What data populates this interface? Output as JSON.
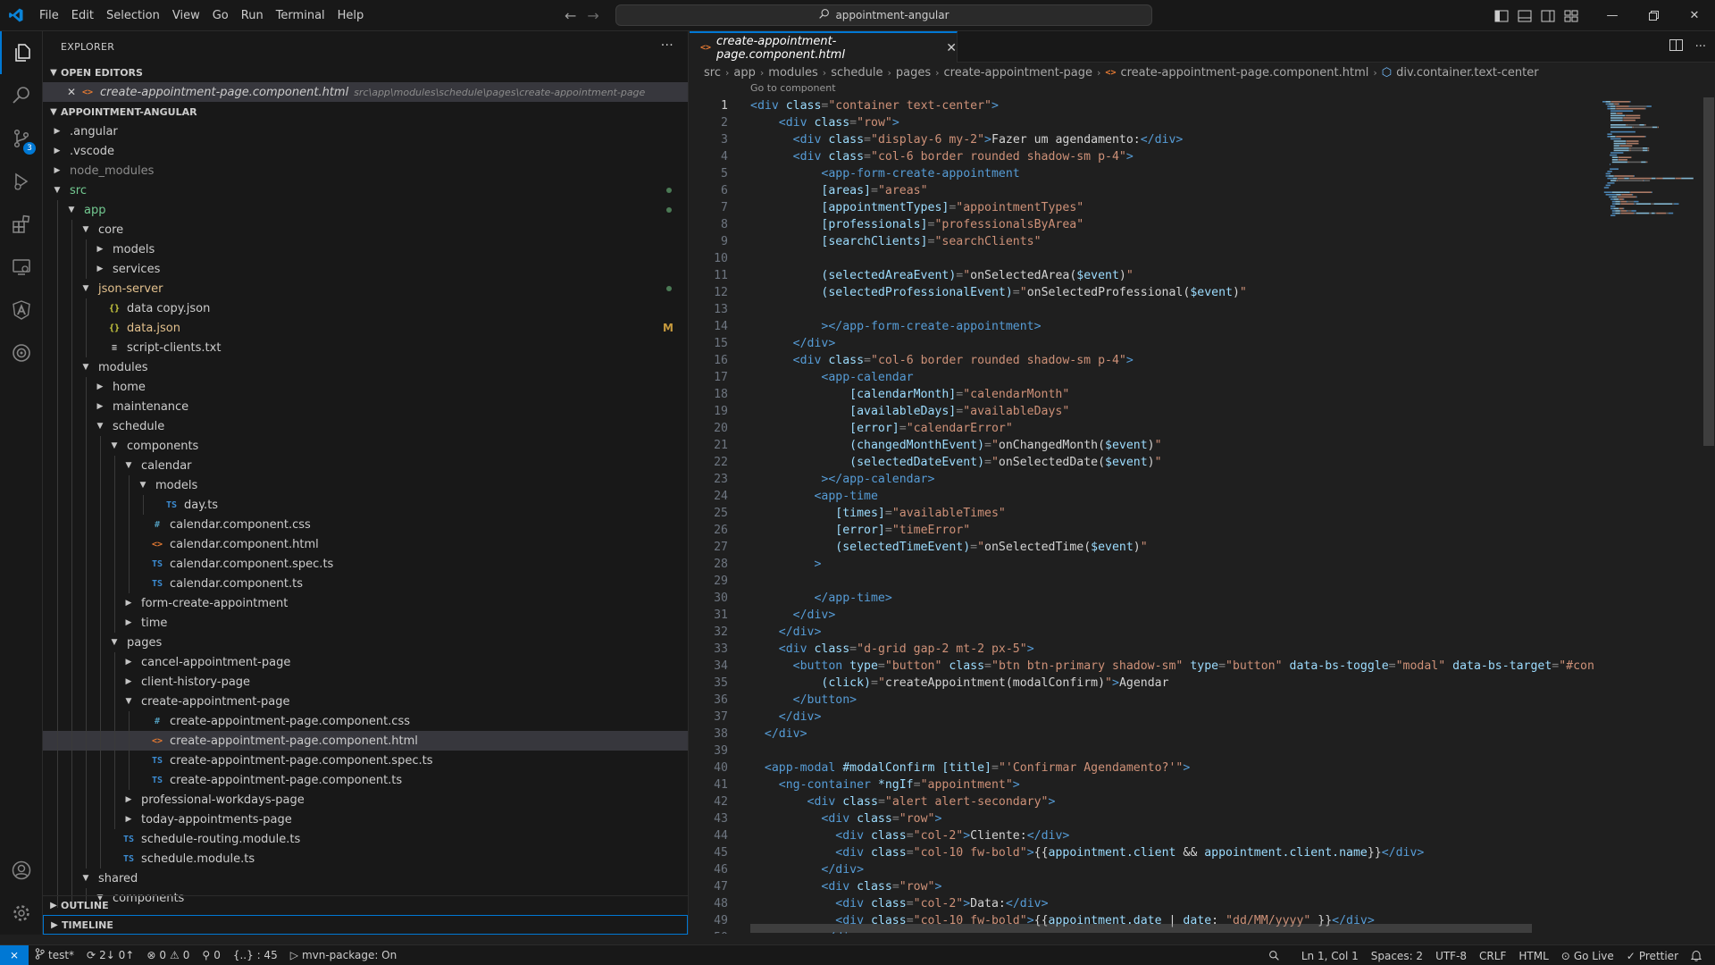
{
  "menu": [
    "File",
    "Edit",
    "Selection",
    "View",
    "Go",
    "Run",
    "Terminal",
    "Help"
  ],
  "command_center": "appointment-angular",
  "activity_badge": "3",
  "explorer": {
    "title": "EXPLORER",
    "open_editors_label": "OPEN EDITORS",
    "open_editor": {
      "name": "create-appointment-page.component.html",
      "path": "src\\app\\modules\\schedule\\pages\\create-appointment-page"
    },
    "project_label": "APPOINTMENT-ANGULAR",
    "tree": [
      {
        "depth": 0,
        "chev": ">",
        "name": ".angular"
      },
      {
        "depth": 0,
        "chev": ">",
        "name": ".vscode"
      },
      {
        "depth": 0,
        "chev": ">",
        "name": "node_modules",
        "dim": true
      },
      {
        "depth": 0,
        "chev": "v",
        "name": "src",
        "dot": true,
        "color": "#73c991"
      },
      {
        "depth": 1,
        "chev": "v",
        "name": "app",
        "dot": true,
        "color": "#73c991"
      },
      {
        "depth": 2,
        "chev": "v",
        "name": "core"
      },
      {
        "depth": 3,
        "chev": ">",
        "name": "models"
      },
      {
        "depth": 3,
        "chev": ">",
        "name": "services"
      },
      {
        "depth": 2,
        "chev": "v",
        "name": "json-server",
        "dot": true,
        "color": "#e2c08d"
      },
      {
        "depth": 3,
        "icon": "{}",
        "iclass": "i-json",
        "name": "data copy.json"
      },
      {
        "depth": 3,
        "icon": "{}",
        "iclass": "i-json",
        "name": "data.json",
        "mflag": "M",
        "color": "#e2c08d"
      },
      {
        "depth": 3,
        "icon": "≡",
        "iclass": "i-txt",
        "name": "script-clients.txt"
      },
      {
        "depth": 2,
        "chev": "v",
        "name": "modules"
      },
      {
        "depth": 3,
        "chev": ">",
        "name": "home"
      },
      {
        "depth": 3,
        "chev": ">",
        "name": "maintenance"
      },
      {
        "depth": 3,
        "chev": "v",
        "name": "schedule"
      },
      {
        "depth": 4,
        "chev": "v",
        "name": "components"
      },
      {
        "depth": 5,
        "chev": "v",
        "name": "calendar"
      },
      {
        "depth": 6,
        "chev": "v",
        "name": "models"
      },
      {
        "depth": 7,
        "icon": "TS",
        "iclass": "i-ts",
        "name": "day.ts"
      },
      {
        "depth": 6,
        "icon": "#",
        "iclass": "i-css",
        "name": "calendar.component.css"
      },
      {
        "depth": 6,
        "icon": "<>",
        "iclass": "i-html",
        "name": "calendar.component.html"
      },
      {
        "depth": 6,
        "icon": "TS",
        "iclass": "i-ts",
        "name": "calendar.component.spec.ts"
      },
      {
        "depth": 6,
        "icon": "TS",
        "iclass": "i-ts",
        "name": "calendar.component.ts"
      },
      {
        "depth": 5,
        "chev": ">",
        "name": "form-create-appointment"
      },
      {
        "depth": 5,
        "chev": ">",
        "name": "time"
      },
      {
        "depth": 4,
        "chev": "v",
        "name": "pages"
      },
      {
        "depth": 5,
        "chev": ">",
        "name": "cancel-appointment-page"
      },
      {
        "depth": 5,
        "chev": ">",
        "name": "client-history-page"
      },
      {
        "depth": 5,
        "chev": "v",
        "name": "create-appointment-page"
      },
      {
        "depth": 6,
        "icon": "#",
        "iclass": "i-css",
        "name": "create-appointment-page.component.css"
      },
      {
        "depth": 6,
        "icon": "<>",
        "iclass": "i-html",
        "name": "create-appointment-page.component.html",
        "selected": true
      },
      {
        "depth": 6,
        "icon": "TS",
        "iclass": "i-ts",
        "name": "create-appointment-page.component.spec.ts"
      },
      {
        "depth": 6,
        "icon": "TS",
        "iclass": "i-ts",
        "name": "create-appointment-page.component.ts"
      },
      {
        "depth": 5,
        "chev": ">",
        "name": "professional-workdays-page"
      },
      {
        "depth": 5,
        "chev": ">",
        "name": "today-appointments-page"
      },
      {
        "depth": 4,
        "icon": "TS",
        "iclass": "i-ts",
        "name": "schedule-routing.module.ts"
      },
      {
        "depth": 4,
        "icon": "TS",
        "iclass": "i-ts",
        "name": "schedule.module.ts"
      },
      {
        "depth": 2,
        "chev": "v",
        "name": "shared"
      },
      {
        "depth": 3,
        "chev": "v",
        "name": "components"
      }
    ],
    "outline_label": "OUTLINE",
    "timeline_label": "TIMELINE"
  },
  "editor": {
    "tab_label": "create-appointment-page.component.html",
    "breadcrumb": [
      "src",
      "app",
      "modules",
      "schedule",
      "pages",
      "create-appointment-page",
      "create-appointment-page.component.html",
      "div.container.text-center"
    ],
    "codelens": "Go to component",
    "lines": [
      [
        [
          0,
          "<div"
        ],
        [
          1,
          " class"
        ],
        [
          2,
          "="
        ],
        [
          3,
          "\"container text-center\""
        ],
        [
          0,
          ">"
        ]
      ],
      [
        [
          4,
          "    "
        ],
        [
          0,
          "<div"
        ],
        [
          1,
          " class"
        ],
        [
          2,
          "="
        ],
        [
          3,
          "\"row\""
        ],
        [
          0,
          ">"
        ]
      ],
      [
        [
          4,
          "      "
        ],
        [
          0,
          "<div"
        ],
        [
          1,
          " class"
        ],
        [
          2,
          "="
        ],
        [
          3,
          "\"display-6 my-2\""
        ],
        [
          0,
          ">"
        ],
        [
          4,
          "Fazer um agendamento:"
        ],
        [
          0,
          "</div>"
        ]
      ],
      [
        [
          4,
          "      "
        ],
        [
          0,
          "<div"
        ],
        [
          1,
          " class"
        ],
        [
          2,
          "="
        ],
        [
          3,
          "\"col-6 border rounded shadow-sm p-4\""
        ],
        [
          0,
          ">"
        ]
      ],
      [
        [
          4,
          "          "
        ],
        [
          0,
          "<app-form-create-appointment"
        ]
      ],
      [
        [
          4,
          "          "
        ],
        [
          1,
          "[areas]"
        ],
        [
          2,
          "="
        ],
        [
          3,
          "\"areas\""
        ]
      ],
      [
        [
          4,
          "          "
        ],
        [
          1,
          "[appointmentTypes]"
        ],
        [
          2,
          "="
        ],
        [
          3,
          "\"appointmentTypes\""
        ]
      ],
      [
        [
          4,
          "          "
        ],
        [
          1,
          "[professionals]"
        ],
        [
          2,
          "="
        ],
        [
          3,
          "\"professionalsByArea\""
        ]
      ],
      [
        [
          4,
          "          "
        ],
        [
          1,
          "[searchClients]"
        ],
        [
          2,
          "="
        ],
        [
          3,
          "\"searchClients\""
        ]
      ],
      [],
      [
        [
          4,
          "          "
        ],
        [
          1,
          "(selectedAreaEvent)"
        ],
        [
          2,
          "="
        ],
        [
          3,
          "\""
        ],
        [
          4,
          "onSelectedArea("
        ],
        [
          1,
          "$event"
        ],
        [
          4,
          ")"
        ],
        [
          3,
          "\""
        ]
      ],
      [
        [
          4,
          "          "
        ],
        [
          1,
          "(selectedProfessionalEvent)"
        ],
        [
          2,
          "="
        ],
        [
          3,
          "\""
        ],
        [
          4,
          "onSelectedProfessional("
        ],
        [
          1,
          "$event"
        ],
        [
          4,
          ")"
        ],
        [
          3,
          "\""
        ]
      ],
      [],
      [
        [
          4,
          "          "
        ],
        [
          0,
          "></app-form-create-appointment>"
        ]
      ],
      [
        [
          4,
          "      "
        ],
        [
          0,
          "</div>"
        ]
      ],
      [
        [
          4,
          "      "
        ],
        [
          0,
          "<div"
        ],
        [
          1,
          " class"
        ],
        [
          2,
          "="
        ],
        [
          3,
          "\"col-6 border rounded shadow-sm p-4\""
        ],
        [
          0,
          ">"
        ]
      ],
      [
        [
          4,
          "          "
        ],
        [
          0,
          "<app-calendar"
        ]
      ],
      [
        [
          4,
          "              "
        ],
        [
          1,
          "[calendarMonth]"
        ],
        [
          2,
          "="
        ],
        [
          3,
          "\"calendarMonth\""
        ]
      ],
      [
        [
          4,
          "              "
        ],
        [
          1,
          "[availableDays]"
        ],
        [
          2,
          "="
        ],
        [
          3,
          "\"availableDays\""
        ]
      ],
      [
        [
          4,
          "              "
        ],
        [
          1,
          "[error]"
        ],
        [
          2,
          "="
        ],
        [
          3,
          "\"calendarError\""
        ]
      ],
      [
        [
          4,
          "              "
        ],
        [
          1,
          "(changedMonthEvent)"
        ],
        [
          2,
          "="
        ],
        [
          3,
          "\""
        ],
        [
          4,
          "onChangedMonth("
        ],
        [
          1,
          "$event"
        ],
        [
          4,
          ")"
        ],
        [
          3,
          "\""
        ]
      ],
      [
        [
          4,
          "              "
        ],
        [
          1,
          "(selectedDateEvent)"
        ],
        [
          2,
          "="
        ],
        [
          3,
          "\""
        ],
        [
          4,
          "onSelectedDate("
        ],
        [
          1,
          "$event"
        ],
        [
          4,
          ")"
        ],
        [
          3,
          "\""
        ]
      ],
      [
        [
          4,
          "          "
        ],
        [
          0,
          "></app-calendar>"
        ]
      ],
      [
        [
          4,
          "         "
        ],
        [
          0,
          "<app-time"
        ]
      ],
      [
        [
          4,
          "            "
        ],
        [
          1,
          "[times]"
        ],
        [
          2,
          "="
        ],
        [
          3,
          "\"availableTimes\""
        ]
      ],
      [
        [
          4,
          "            "
        ],
        [
          1,
          "[error]"
        ],
        [
          2,
          "="
        ],
        [
          3,
          "\"timeError\""
        ]
      ],
      [
        [
          4,
          "            "
        ],
        [
          1,
          "(selectedTimeEvent)"
        ],
        [
          2,
          "="
        ],
        [
          3,
          "\""
        ],
        [
          4,
          "onSelectedTime("
        ],
        [
          1,
          "$event"
        ],
        [
          4,
          ")"
        ],
        [
          3,
          "\""
        ]
      ],
      [
        [
          4,
          "         "
        ],
        [
          0,
          ">"
        ]
      ],
      [],
      [
        [
          4,
          "         "
        ],
        [
          0,
          "</app-time>"
        ]
      ],
      [
        [
          4,
          "      "
        ],
        [
          0,
          "</div>"
        ]
      ],
      [
        [
          4,
          "    "
        ],
        [
          0,
          "</div>"
        ]
      ],
      [
        [
          4,
          "    "
        ],
        [
          0,
          "<div"
        ],
        [
          1,
          " class"
        ],
        [
          2,
          "="
        ],
        [
          3,
          "\"d-grid gap-2 mt-2 px-5\""
        ],
        [
          0,
          ">"
        ]
      ],
      [
        [
          4,
          "      "
        ],
        [
          0,
          "<button"
        ],
        [
          1,
          " type"
        ],
        [
          2,
          "="
        ],
        [
          3,
          "\"button\""
        ],
        [
          1,
          " class"
        ],
        [
          2,
          "="
        ],
        [
          3,
          "\"btn btn-primary shadow-sm\""
        ],
        [
          1,
          " type"
        ],
        [
          2,
          "="
        ],
        [
          3,
          "\"button\""
        ],
        [
          1,
          " data-bs-toggle"
        ],
        [
          2,
          "="
        ],
        [
          3,
          "\"modal\""
        ],
        [
          1,
          " data-bs-target"
        ],
        [
          2,
          "="
        ],
        [
          3,
          "\"#confirm"
        ]
      ],
      [
        [
          4,
          "          "
        ],
        [
          1,
          "(click)"
        ],
        [
          2,
          "="
        ],
        [
          3,
          "\""
        ],
        [
          4,
          "createAppointment(modalConfirm)"
        ],
        [
          3,
          "\""
        ],
        [
          0,
          ">"
        ],
        [
          4,
          "Agendar"
        ]
      ],
      [
        [
          4,
          "      "
        ],
        [
          0,
          "</button>"
        ]
      ],
      [
        [
          4,
          "    "
        ],
        [
          0,
          "</div>"
        ]
      ],
      [
        [
          4,
          "  "
        ],
        [
          0,
          "</div>"
        ]
      ],
      [],
      [
        [
          4,
          "  "
        ],
        [
          0,
          "<app-modal"
        ],
        [
          1,
          " #modalConfirm"
        ],
        [
          1,
          " [title]"
        ],
        [
          2,
          "="
        ],
        [
          3,
          "\"'Confirmar Agendamento?'\""
        ],
        [
          0,
          ">"
        ]
      ],
      [
        [
          4,
          "    "
        ],
        [
          0,
          "<ng-container"
        ],
        [
          1,
          " *ngIf"
        ],
        [
          2,
          "="
        ],
        [
          3,
          "\"appointment\""
        ],
        [
          0,
          ">"
        ]
      ],
      [
        [
          4,
          "        "
        ],
        [
          0,
          "<div"
        ],
        [
          1,
          " class"
        ],
        [
          2,
          "="
        ],
        [
          3,
          "\"alert alert-secondary\""
        ],
        [
          0,
          ">"
        ]
      ],
      [
        [
          4,
          "          "
        ],
        [
          0,
          "<div"
        ],
        [
          1,
          " class"
        ],
        [
          2,
          "="
        ],
        [
          3,
          "\"row\""
        ],
        [
          0,
          ">"
        ]
      ],
      [
        [
          4,
          "            "
        ],
        [
          0,
          "<div"
        ],
        [
          1,
          " class"
        ],
        [
          2,
          "="
        ],
        [
          3,
          "\"col-2\""
        ],
        [
          0,
          ">"
        ],
        [
          4,
          "Cliente:"
        ],
        [
          0,
          "</div>"
        ]
      ],
      [
        [
          4,
          "            "
        ],
        [
          0,
          "<div"
        ],
        [
          1,
          " class"
        ],
        [
          2,
          "="
        ],
        [
          3,
          "\"col-10 fw-bold\""
        ],
        [
          0,
          ">"
        ],
        [
          4,
          "{{"
        ],
        [
          1,
          "appointment.client"
        ],
        [
          4,
          " && "
        ],
        [
          1,
          "appointment.client.name"
        ],
        [
          4,
          "}}"
        ],
        [
          0,
          "</div>"
        ]
      ],
      [
        [
          4,
          "          "
        ],
        [
          0,
          "</div>"
        ]
      ],
      [
        [
          4,
          "          "
        ],
        [
          0,
          "<div"
        ],
        [
          1,
          " class"
        ],
        [
          2,
          "="
        ],
        [
          3,
          "\"row\""
        ],
        [
          0,
          ">"
        ]
      ],
      [
        [
          4,
          "            "
        ],
        [
          0,
          "<div"
        ],
        [
          1,
          " class"
        ],
        [
          2,
          "="
        ],
        [
          3,
          "\"col-2\""
        ],
        [
          0,
          ">"
        ],
        [
          4,
          "Data:"
        ],
        [
          0,
          "</div>"
        ]
      ],
      [
        [
          4,
          "            "
        ],
        [
          0,
          "<div"
        ],
        [
          1,
          " class"
        ],
        [
          2,
          "="
        ],
        [
          3,
          "\"col-10 fw-bold\""
        ],
        [
          0,
          ">"
        ],
        [
          4,
          "{{"
        ],
        [
          1,
          "appointment.date"
        ],
        [
          4,
          " | "
        ],
        [
          1,
          "date"
        ],
        [
          4,
          ": "
        ],
        [
          3,
          "\"dd/MM/yyyy\""
        ],
        [
          4,
          " }}"
        ],
        [
          0,
          "</div>"
        ]
      ],
      [
        [
          4,
          "          "
        ],
        [
          0,
          "</div>"
        ]
      ]
    ]
  },
  "status": {
    "branch": "test*",
    "sync": "2↓ 0↑",
    "problems_errors": "0",
    "problems_warnings": "0",
    "ports": "0",
    "selection_info": "{..} : 45",
    "task": "mvn-package: On",
    "position": "Ln 1, Col 1",
    "spaces": "Spaces: 2",
    "encoding": "UTF-8",
    "eol": "CRLF",
    "language": "HTML",
    "golive": "Go Live",
    "prettier": "Prettier"
  },
  "colors": {
    "accent": "#0078d4",
    "sidebar_bg": "#181818",
    "editor_bg": "#1f1f1f"
  }
}
